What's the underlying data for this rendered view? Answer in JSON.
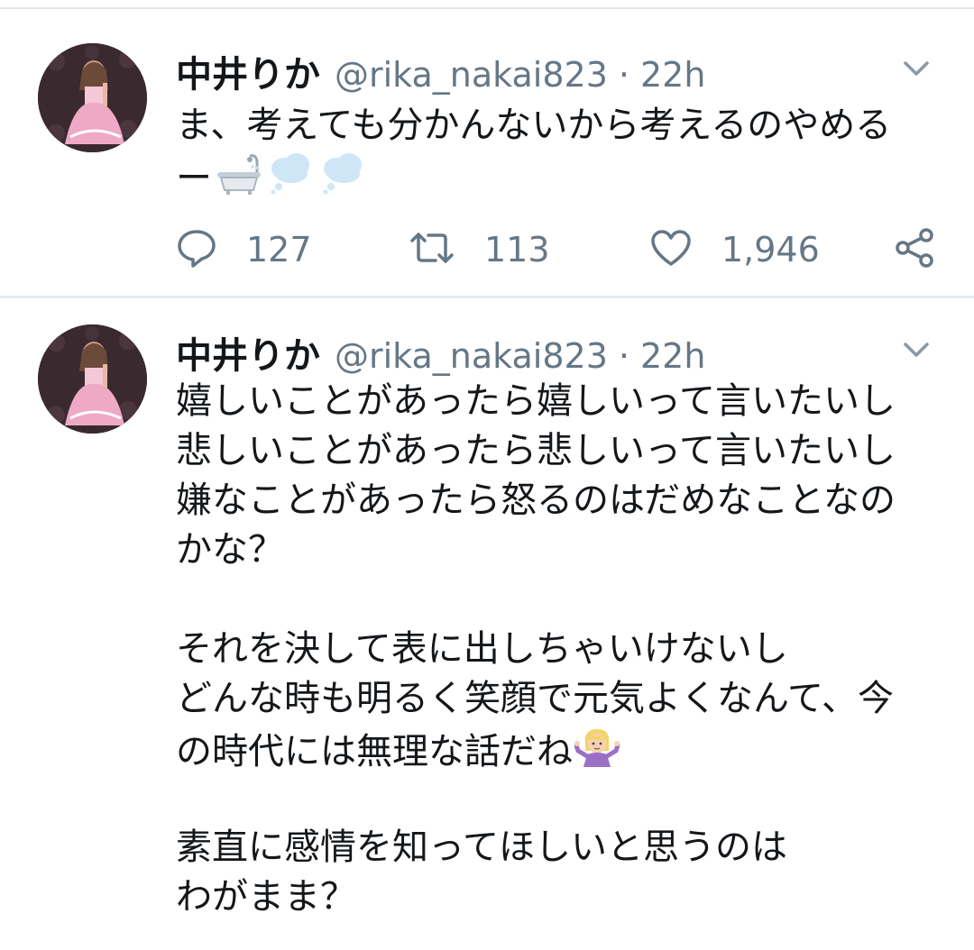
{
  "tweets": [
    {
      "name": "中井りか",
      "handle": "@rika_nakai823",
      "separator": "·",
      "time": "22h",
      "lines": [
        "ま、考えても分かんないから考えるのやめる",
        "ー"
      ],
      "emojis": [
        "bathtub",
        "thought-balloon",
        "thought-balloon"
      ],
      "reply_count": "127",
      "retweet_count": "113",
      "like_count": "1,946"
    },
    {
      "name": "中井りか",
      "handle": "@rika_nakai823",
      "separator": "·",
      "time": "22h",
      "lines": [
        "嬉しいことがあったら嬉しいって言いたいし",
        "悲しいことがあったら悲しいって言いたいし",
        "嫌なことがあったら怒るのはだめなことなの",
        "かな？",
        "",
        "それを決して表に出しちゃいけないし",
        "どんな時も明るく笑顔で元気よくなんて、今",
        "の時代には無理な話だね",
        "",
        "素直に感情を知ってほしいと思うのは",
        "わがまま？"
      ],
      "emojis": [
        "person-shrugging"
      ]
    }
  ],
  "colors": {
    "text": "#14171a",
    "secondary": "#657786",
    "divider": "#e6ecf0"
  },
  "icons": {
    "reply": "reply-icon",
    "retweet": "retweet-icon",
    "like": "heart-icon",
    "share": "share-icon",
    "menu": "chevron-down-icon"
  }
}
